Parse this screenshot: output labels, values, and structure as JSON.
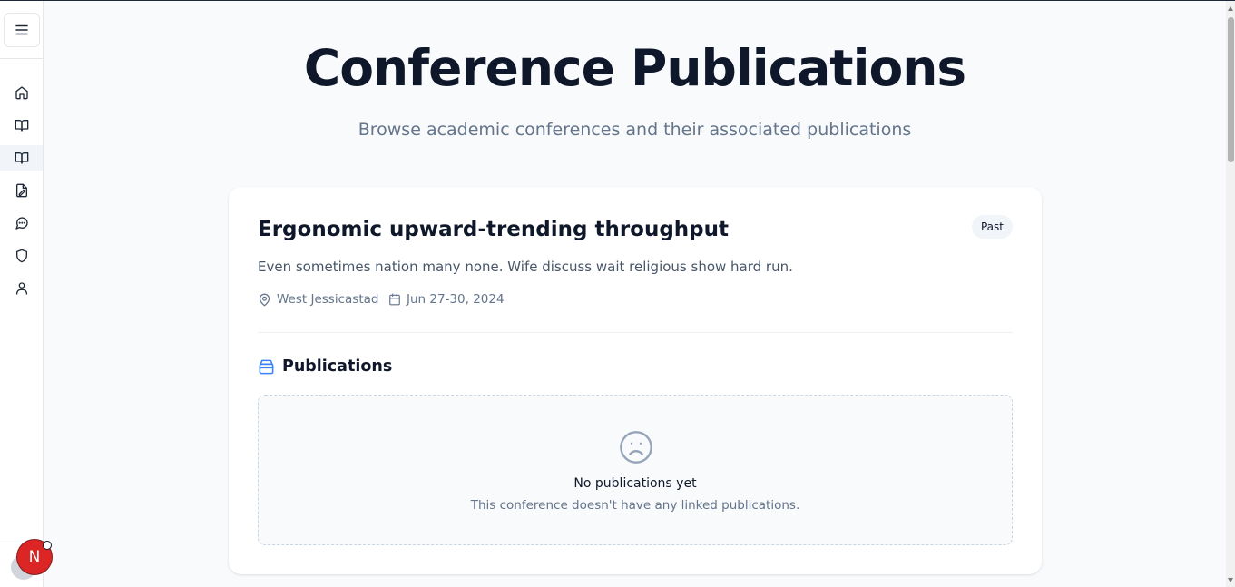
{
  "sidebar": {
    "menu_icon": "hamburger-icon",
    "items": [
      {
        "name": "home",
        "icon": "home-icon"
      },
      {
        "name": "book",
        "icon": "book-open-icon"
      },
      {
        "name": "conferences",
        "icon": "book-open-icon",
        "active": true
      },
      {
        "name": "papers",
        "icon": "file-edit-icon"
      },
      {
        "name": "messages",
        "icon": "chat-icon"
      },
      {
        "name": "security",
        "icon": "shield-icon"
      },
      {
        "name": "profile",
        "icon": "user-icon"
      }
    ],
    "avatar_initial": "N"
  },
  "header": {
    "title": "Conference Publications",
    "subtitle": "Browse academic conferences and their associated publications"
  },
  "conference": {
    "title": "Ergonomic upward-trending throughput",
    "status": "Past",
    "description": "Even sometimes nation many none. Wife discuss wait religious show hard run.",
    "location": "West Jessicastad",
    "dates": "Jun 27-30, 2024",
    "publications_heading": "Publications",
    "empty_title": "No publications yet",
    "empty_description": "This conference doesn't have any linked publications."
  },
  "colors": {
    "accent": "#3b82f6",
    "avatar": "#dc2626",
    "title": "#0f172a",
    "muted": "#64748b"
  }
}
